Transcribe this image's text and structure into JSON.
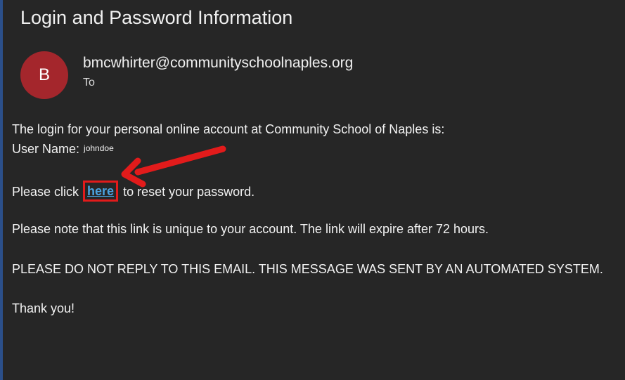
{
  "email": {
    "subject": "Login and Password Information",
    "avatar_initial": "B",
    "sender": "bmcwhirter@communityschoolnaples.org",
    "to_label": "To",
    "body": {
      "line1": "The login for your personal online account at Community School of Naples is:",
      "username_label": "User Name:",
      "username_value": "johndoe",
      "reset_prefix": "Please click",
      "reset_link": "here",
      "reset_suffix": "to reset your password.",
      "note": "Please note that this link is unique to your account. The link will expire after 72 hours.",
      "warning": "PLEASE DO NOT REPLY TO THIS EMAIL. THIS MESSAGE WAS SENT BY AN AUTOMATED SYSTEM.",
      "closing": "Thank you!"
    }
  },
  "colors": {
    "background": "#262626",
    "avatar": "#a4262c",
    "link": "#4aa3e0",
    "highlight": "#e21b1b"
  },
  "annotation": {
    "icon": "red-arrow-icon"
  }
}
